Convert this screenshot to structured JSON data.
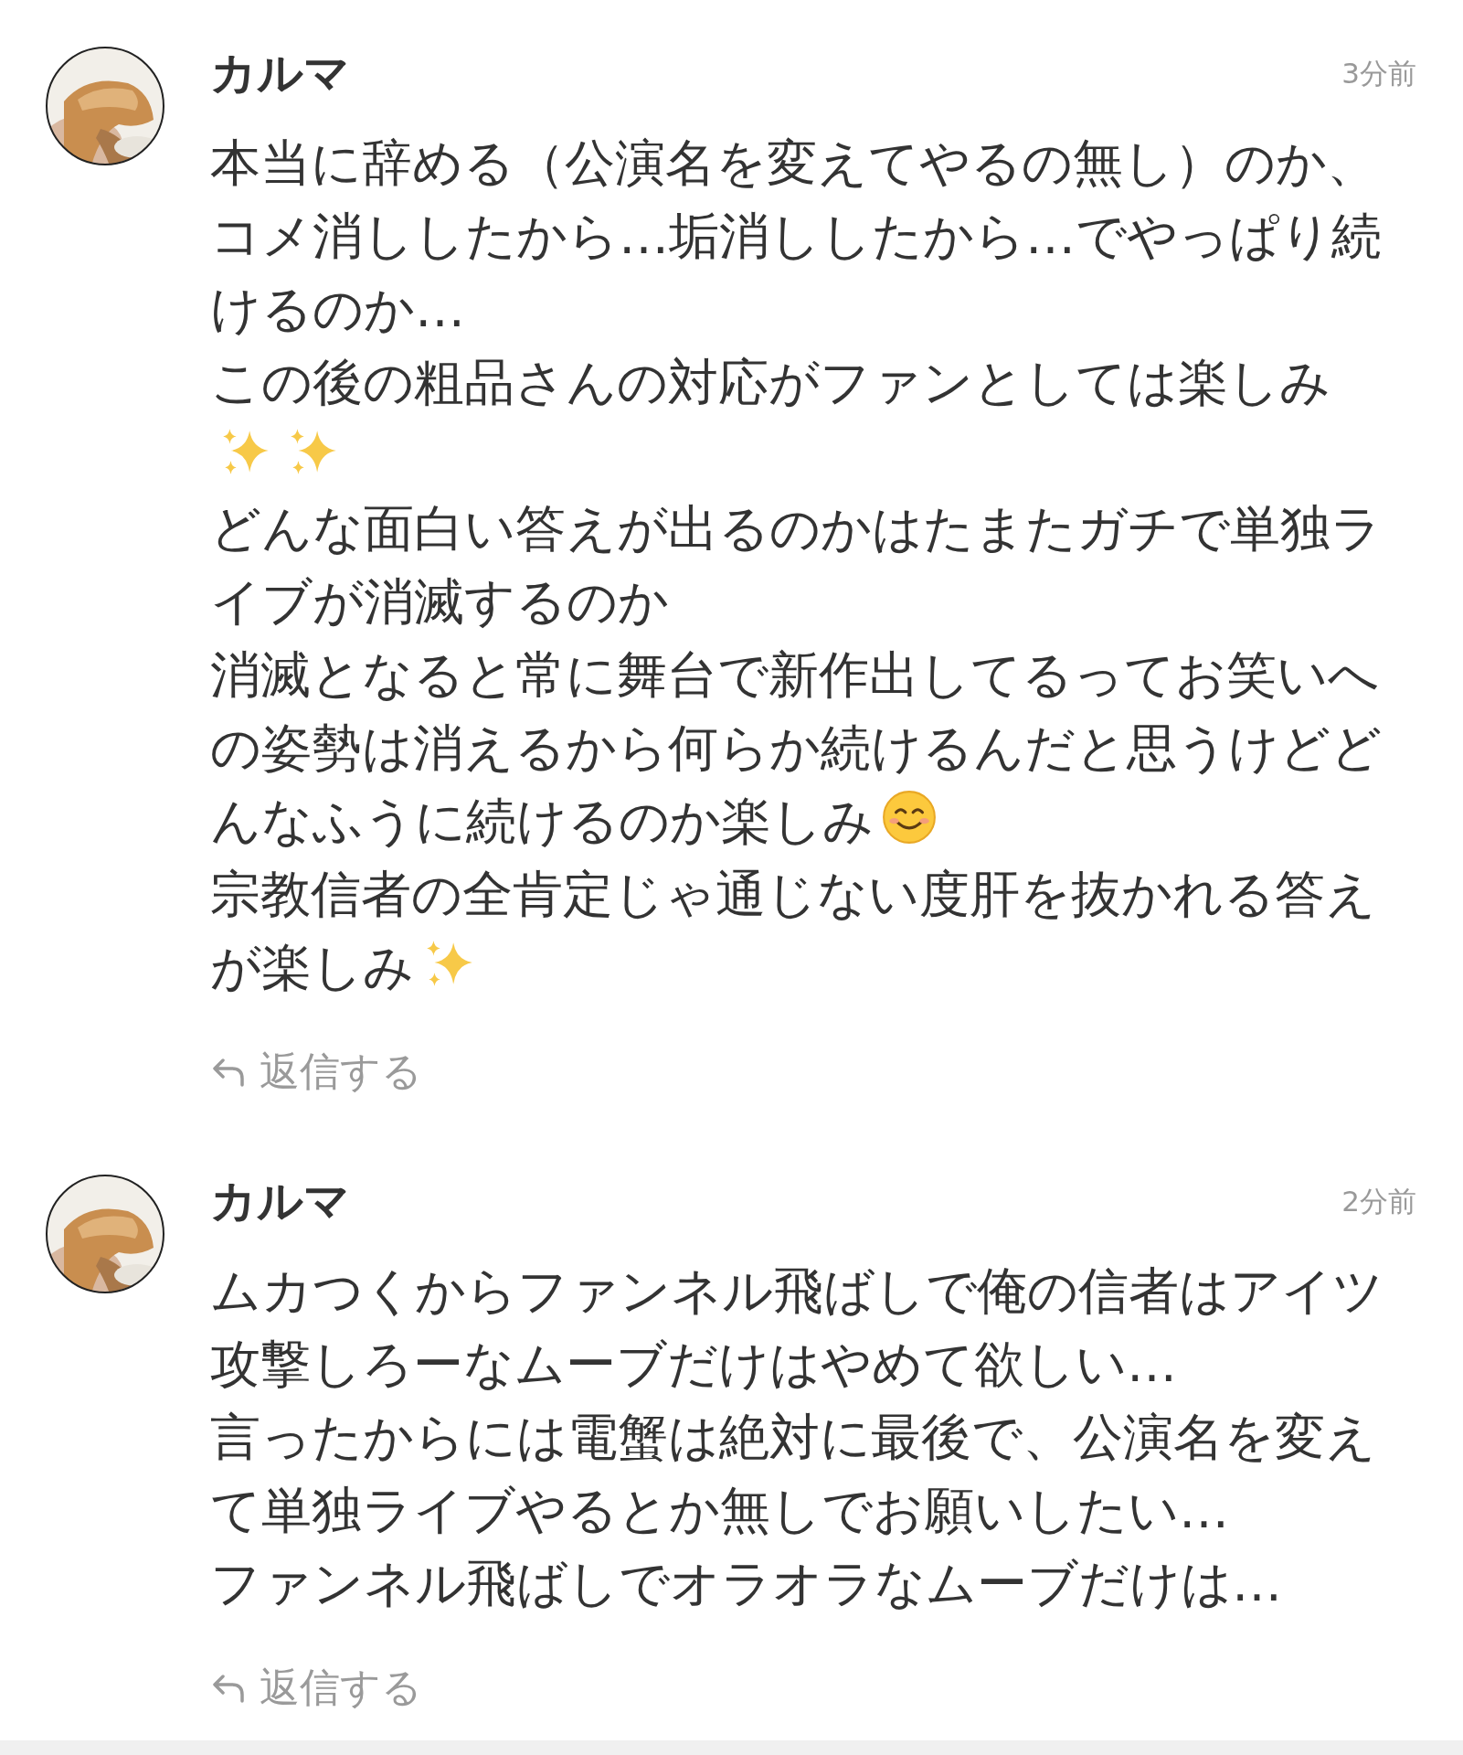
{
  "comments": [
    {
      "avatar": {
        "kind": "picture"
      },
      "author": "カルマ",
      "time": "3分前",
      "paragraphs": [
        [
          {
            "kind": "text",
            "text": "本当に辞める（公演名を変えてやるの無し）のか、"
          }
        ],
        [
          {
            "kind": "text",
            "text": "コメ消ししたから…垢消ししたから…でやっぱり続けるのか…"
          }
        ],
        [
          {
            "kind": "text",
            "text": "この後の粗品さんの対応がファンとしては楽しみ"
          },
          {
            "kind": "sparkles"
          },
          {
            "kind": "sparkles"
          }
        ],
        [
          {
            "kind": "text",
            "text": "どんな面白い答えが出るのかはたまたガチで単独ライブが消滅するのか"
          }
        ],
        [
          {
            "kind": "text",
            "text": "消滅となると常に舞台で新作出してるってお笑いへの姿勢は消えるから何らか続けるんだと思うけどどんなふうに続けるのか楽しみ"
          },
          {
            "kind": "smile"
          }
        ],
        [
          {
            "kind": "text",
            "text": "宗教信者の全肯定じゃ通じない度肝を抜かれる答えが楽しみ"
          },
          {
            "kind": "sparkles"
          }
        ]
      ],
      "reply": "返信する"
    },
    {
      "avatar": {
        "kind": "picture"
      },
      "author": "カルマ",
      "time": "2分前",
      "paragraphs": [
        [
          {
            "kind": "text",
            "text": "ムカつくからファンネル飛ばしで俺の信者はアイツ攻撃しろーなムーブだけはやめて欲しい…"
          }
        ],
        [
          {
            "kind": "text",
            "text": "言ったからには電蟹は絶対に最後で、公演名を変えて単独ライブやるとか無しでお願いしたい…"
          }
        ],
        [
          {
            "kind": "text",
            "text": "ファンネル飛ばしでオラオラなムーブだけは…"
          }
        ]
      ],
      "reply": "返信する"
    }
  ]
}
